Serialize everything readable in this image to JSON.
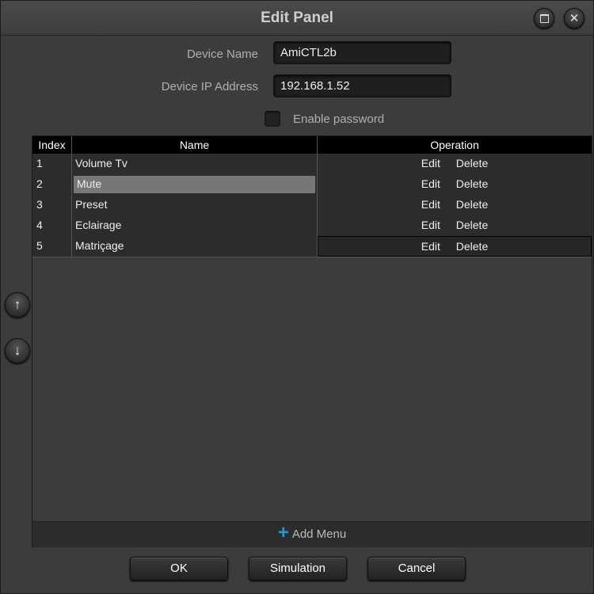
{
  "window": {
    "title": "Edit Panel"
  },
  "form": {
    "device_name_label": "Device Name",
    "device_name_value": "AmiCTL2b",
    "device_ip_label": "Device IP Address",
    "device_ip_value": "192.168.1.52",
    "enable_password_label": "Enable password",
    "enable_password_checked": false
  },
  "table": {
    "columns": [
      "Index",
      "Name",
      "Operation"
    ],
    "rows": [
      {
        "index": "1",
        "name": "Volume Tv",
        "edit": "Edit",
        "delete": "Delete"
      },
      {
        "index": "2",
        "name": "Mute",
        "edit": "Edit",
        "delete": "Delete"
      },
      {
        "index": "3",
        "name": "Preset",
        "edit": "Edit",
        "delete": "Delete"
      },
      {
        "index": "4",
        "name": "Eclairage",
        "edit": "Edit",
        "delete": "Delete"
      },
      {
        "index": "5",
        "name": "Matriçage",
        "edit": "Edit",
        "delete": "Delete"
      }
    ],
    "add_menu_label": "Add Menu",
    "add_icon": "plus-icon"
  },
  "side_icons": {
    "up": "arrow-up-icon",
    "down": "arrow-down-icon"
  },
  "buttons": {
    "ok": "OK",
    "simulation": "Simulation",
    "cancel": "Cancel"
  },
  "colors": {
    "accent_plus": "#1e9ad6",
    "background": "#3c3c3c",
    "header_bg": "#000000"
  }
}
